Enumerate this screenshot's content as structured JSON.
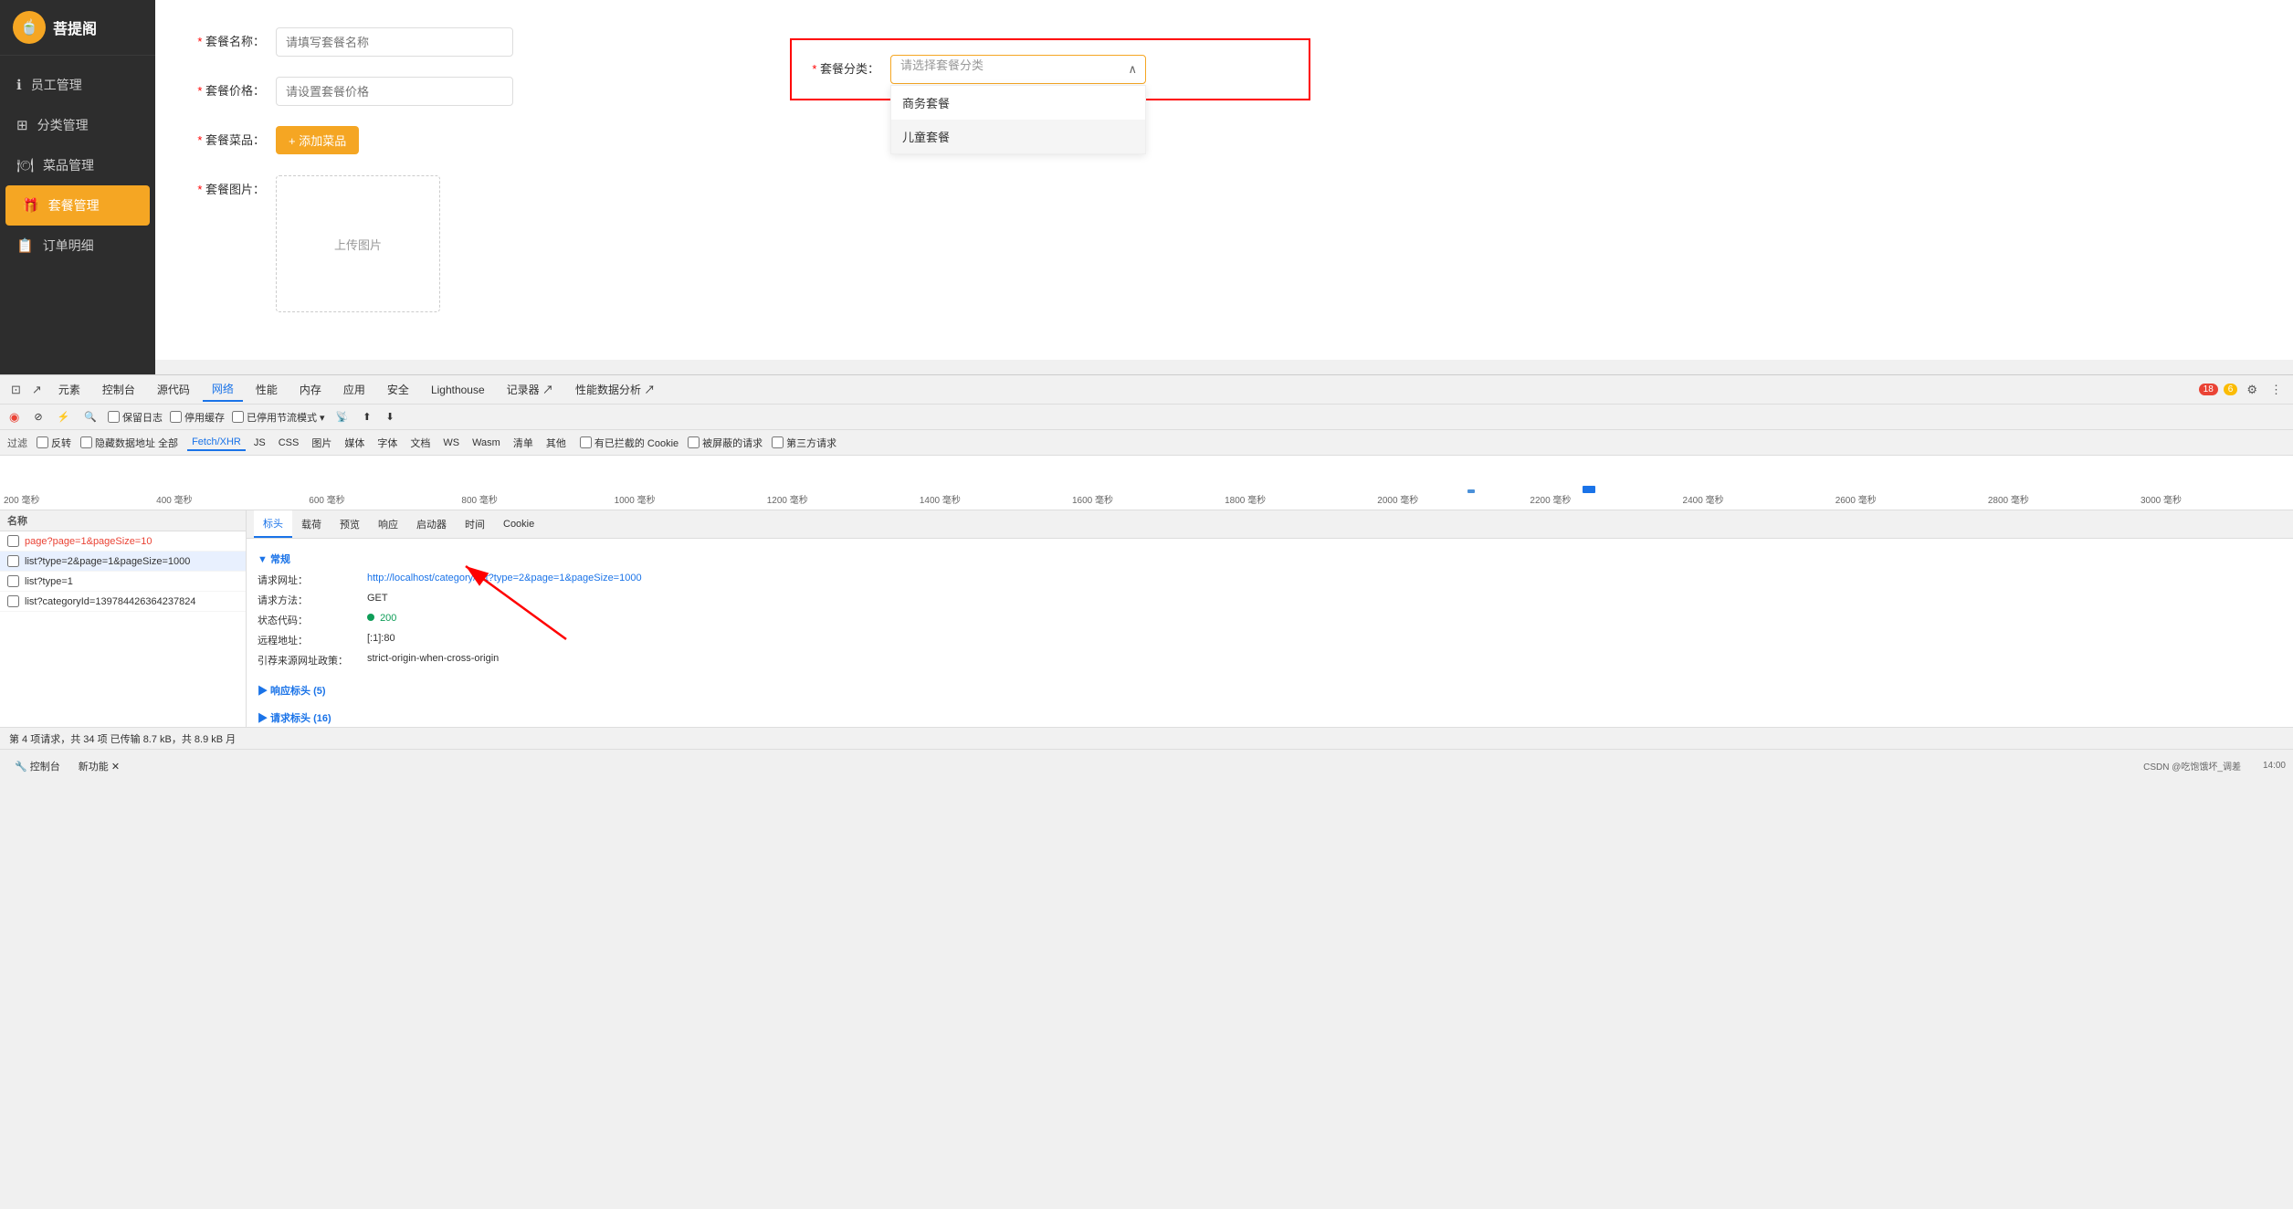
{
  "sidebar": {
    "logo_text": "菩提阁",
    "items": [
      {
        "id": "staff",
        "label": "员工管理",
        "icon": "ℹ️",
        "active": false
      },
      {
        "id": "category",
        "label": "分类管理",
        "icon": "⊞",
        "active": false
      },
      {
        "id": "dishes",
        "label": "菜品管理",
        "icon": "🍽",
        "active": false
      },
      {
        "id": "combos",
        "label": "套餐管理",
        "icon": "🎁",
        "active": true
      },
      {
        "id": "orders",
        "label": "订单明细",
        "icon": "📋",
        "active": false
      }
    ]
  },
  "form": {
    "name_label": "套餐名称：",
    "name_placeholder": "请填写套餐名称",
    "price_label": "套餐价格：",
    "price_placeholder": "请设置套餐价格",
    "dishes_label": "套餐菜品：",
    "add_btn": "+ 添加菜品",
    "image_label": "套餐图片：",
    "upload_text": "上传图片"
  },
  "category_box": {
    "label": "套餐分类：",
    "placeholder": "请选择套餐分类",
    "options": [
      {
        "label": "商务套餐",
        "highlighted": false
      },
      {
        "label": "儿童套餐",
        "highlighted": true
      }
    ]
  },
  "devtools": {
    "tabs": [
      {
        "label": "元素",
        "active": false
      },
      {
        "label": "控制台",
        "active": false
      },
      {
        "label": "源代码",
        "active": false
      },
      {
        "label": "网络",
        "active": true
      },
      {
        "label": "性能",
        "active": false
      },
      {
        "label": "内存",
        "active": false
      },
      {
        "label": "应用",
        "active": false
      },
      {
        "label": "安全",
        "active": false
      },
      {
        "label": "Lighthouse",
        "active": false
      },
      {
        "label": "记录器 ↗",
        "active": false
      },
      {
        "label": "性能数据分析 ↗",
        "active": false
      }
    ],
    "toolbar_btns": [
      {
        "label": "◉",
        "title": "record",
        "red": true
      },
      {
        "label": "⊘",
        "title": "clear"
      },
      {
        "label": "⚡",
        "title": "filter-icon"
      },
      {
        "label": "🔍",
        "title": "search"
      },
      {
        "label": "□ 保留日志",
        "title": "preserve-log"
      },
      {
        "label": "□ 停用缓存",
        "title": "disable-cache"
      },
      {
        "label": "□停用节流模式 ▾",
        "title": "throttle"
      },
      {
        "label": "📡",
        "title": "network-conditions"
      },
      {
        "label": "⬆",
        "title": "import"
      },
      {
        "label": "⬇",
        "title": "export"
      }
    ],
    "filter_types": [
      "反转",
      "隐藏数据地址 全部",
      "Fetch/XHR",
      "JS",
      "CSS",
      "图片",
      "媒体",
      "字体",
      "文档",
      "WS",
      "Wasm",
      "清单",
      "其他",
      "□ 有已拦截的 Cookie",
      "□ 被屏蔽的请求",
      "□ 第三方请求"
    ],
    "error_count": "18",
    "warning_count": "6",
    "timeline_labels": [
      "200 毫秒",
      "400 毫秒",
      "600 毫秒",
      "800 毫秒",
      "1000 毫秒",
      "1200 毫秒",
      "1400 毫秒",
      "1600 毫秒",
      "1800 毫秒",
      "2000 毫秒",
      "2200 毫秒",
      "2400 毫秒",
      "2600 毫秒",
      "2800 毫秒",
      "3000 毫秒"
    ],
    "network_items": [
      {
        "id": 1,
        "text": "page?page=1&pageSize=10",
        "red": true
      },
      {
        "id": 2,
        "text": "list?type=2&page=1&pageSize=1000",
        "selected": true,
        "red": false
      },
      {
        "id": 3,
        "text": "list?type=1",
        "red": false
      },
      {
        "id": 4,
        "text": "list?categoryId=139784426364237824",
        "red": false
      }
    ],
    "detail_tabs": [
      "标头",
      "载荷",
      "预览",
      "响应",
      "启动器",
      "时间",
      "Cookie"
    ],
    "active_detail_tab": "标头",
    "sections": {
      "general": {
        "label": "▼ 常规",
        "rows": [
          {
            "key": "请求网址：",
            "value": "http://localhost/category/list?type=2&page=1&pageSize=1000",
            "color": "blue"
          },
          {
            "key": "请求方法：",
            "value": "GET",
            "color": "black"
          },
          {
            "key": "状态代码：",
            "value": "200",
            "color": "green",
            "dot": true
          },
          {
            "key": "远程地址：",
            "value": "[:1]:80",
            "color": "black"
          },
          {
            "key": "引荐来源网址政策：",
            "value": "strict-origin-when-cross-origin",
            "color": "black"
          }
        ]
      },
      "response_headers": {
        "label": "▶ 响应标头 (5)"
      },
      "request_headers": {
        "label": "▶ 请求标头 (16)"
      }
    }
  },
  "status_bar": {
    "text": "第 4 项请求，共 34 项  已传输 8.7 kB，共 8.9 kB  月"
  },
  "taskbar": {
    "items": [
      {
        "label": "🔧 控制台"
      },
      {
        "label": "新功能 ✕"
      }
    ]
  },
  "bottom_bar": {
    "right_text": "CSDN @吃饱饿坏_调差",
    "time": "14:00"
  }
}
